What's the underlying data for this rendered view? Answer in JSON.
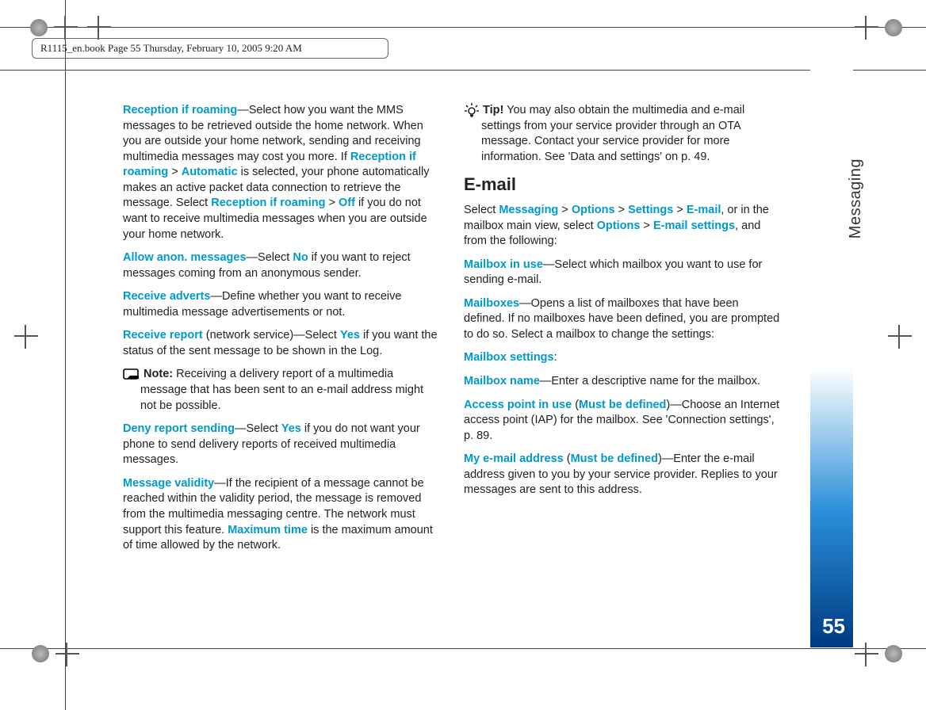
{
  "header": {
    "crop_text": "R1115_en.book  Page 55  Thursday, February 10, 2005  9:20 AM"
  },
  "sidebar": {
    "section_label": "Messaging",
    "page_number": "55"
  },
  "left": {
    "p1a": "Reception if roaming",
    "p1b": "—Select how you want the MMS messages to be retrieved outside the home network. When you are outside your home network, sending and receiving multimedia messages may cost you more. If ",
    "p1c": "Reception if roaming",
    "p1d": " > ",
    "p1e": "Automatic",
    "p1f": " is selected, your phone automatically makes an active packet data connection to retrieve the message. Select ",
    "p1g": "Reception if roaming",
    "p1h": " > ",
    "p1i": "Off",
    "p1j": " if you do not want to receive multimedia messages when you are outside your home network.",
    "p2a": "Allow anon. messages",
    "p2b": "—Select ",
    "p2c": "No",
    "p2d": " if you want to reject messages coming from an anonymous sender.",
    "p3a": "Receive adverts",
    "p3b": "—Define whether you want to receive multimedia message advertisements or not.",
    "p4a": "Receive report",
    "p4b": " (network service)—Select ",
    "p4c": "Yes",
    "p4d": " if you want the status of the sent message to be shown in the Log.",
    "noteLabel": "Note:",
    "noteText": " Receiving a delivery report of a multimedia message that has been sent to an e-mail address might not be possible.",
    "p5a": "Deny report sending",
    "p5b": "—Select ",
    "p5c": "Yes",
    "p5d": " if you do not want your phone to send delivery reports of received multimedia messages.",
    "p6a": "Message validity",
    "p6b": "—If the recipient of a message cannot be reached within the validity period, the message is removed from the multimedia messaging centre. The network must support this feature. ",
    "p6c": "Maximum time",
    "p6d": " is the maximum amount of time allowed by the network."
  },
  "right": {
    "tipLabel": "Tip!",
    "tipText": " You may also obtain the multimedia and e-mail settings from your service provider through an OTA message. Contact your service provider for more information. See 'Data and settings' on p. 49.",
    "h_email": "E-mail",
    "e1a": "Select ",
    "e1b": "Messaging",
    "e1c": " > ",
    "e1d": "Options",
    "e1e": " > ",
    "e1f": "Settings",
    "e1g": " > ",
    "e1h": "E-mail",
    "e1i": ", or in the mailbox main view, select ",
    "e1j": "Options",
    "e1k": " > ",
    "e1l": "E-mail settings",
    "e1m": ", and from the following:",
    "e2a": "Mailbox in use",
    "e2b": "—Select which mailbox you want to use for sending e-mail.",
    "e3a": "Mailboxes",
    "e3b": "—Opens a list of mailboxes that have been defined. If no mailboxes have been defined, you are prompted to do so. Select a mailbox to change the settings:",
    "e4a": "Mailbox settings",
    "e4b": ":",
    "e5a": "Mailbox name",
    "e5b": "—Enter a descriptive name for the mailbox.",
    "e6a": "Access point in use",
    "e6b": " (",
    "e6c": "Must be defined",
    "e6d": ")—Choose an Internet access point (IAP) for the mailbox. See 'Connection settings', p. 89.",
    "e7a": "My e-mail address",
    "e7b": " (",
    "e7c": "Must be defined",
    "e7d": ")—Enter the e-mail address given to you by your service provider. Replies to your messages are sent to this address."
  }
}
